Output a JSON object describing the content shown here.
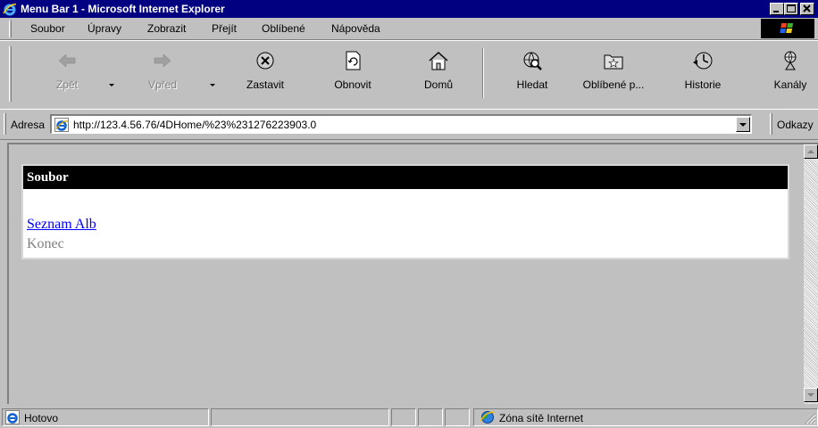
{
  "window": {
    "title": "Menu Bar 1 - Microsoft Internet Explorer"
  },
  "menubar": {
    "items": [
      {
        "label": "Soubor"
      },
      {
        "label": "Úpravy"
      },
      {
        "label": "Zobrazit"
      },
      {
        "label": "Přejít"
      },
      {
        "label": "Oblíbené"
      },
      {
        "label": "Nápověda"
      }
    ]
  },
  "toolbar": {
    "buttons": [
      {
        "label": "Zpět",
        "icon": "back-arrow-icon",
        "enabled": false
      },
      {
        "label": "Vpřed",
        "icon": "forward-arrow-icon",
        "enabled": false
      },
      {
        "label": "Zastavit",
        "icon": "stop-icon",
        "enabled": true
      },
      {
        "label": "Obnovit",
        "icon": "refresh-icon",
        "enabled": true
      },
      {
        "label": "Domů",
        "icon": "home-icon",
        "enabled": true
      },
      {
        "label": "Hledat",
        "icon": "search-globe-icon",
        "enabled": true
      },
      {
        "label": "Oblíbené p...",
        "icon": "favorites-folder-icon",
        "enabled": true
      },
      {
        "label": "Historie",
        "icon": "history-icon",
        "enabled": true
      },
      {
        "label": "Kanály",
        "icon": "channels-icon",
        "enabled": true
      }
    ]
  },
  "addressbar": {
    "label": "Adresa",
    "url": "http://123.4.56.76/4DHome/%23%231276223903.0",
    "links_label": "Odkazy"
  },
  "content": {
    "panel_title": "Soubor",
    "links": [
      {
        "label": "Seznam Alb",
        "active": true
      },
      {
        "label": "Konec",
        "active": false
      }
    ]
  },
  "statusbar": {
    "status": "Hotovo",
    "zone": "Zóna sítě Internet"
  },
  "colors": {
    "titlebar": "#000080",
    "face": "#c0c0c0",
    "link": "#0000ff",
    "disabled": "#808080"
  }
}
